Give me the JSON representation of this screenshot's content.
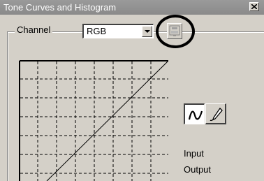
{
  "window": {
    "title": "Tone Curves and Histogram",
    "close_icon": "close-icon"
  },
  "channel": {
    "label": "Channel",
    "selected": "RGB"
  },
  "toolbar": {
    "small_button_icon": "curve-preset-icon",
    "curve_tool_icon": "curve-tool-icon",
    "pencil_tool_icon": "pencil-tool-icon"
  },
  "graph": {
    "curve": "linear",
    "grid": "dashed 4x4"
  },
  "labels": {
    "input": "Input",
    "output": "Output"
  },
  "colors": {
    "titlebar": "#8a8a8a",
    "dialog_bg": "#d4d0c8",
    "highlight_ring": "#000000"
  }
}
